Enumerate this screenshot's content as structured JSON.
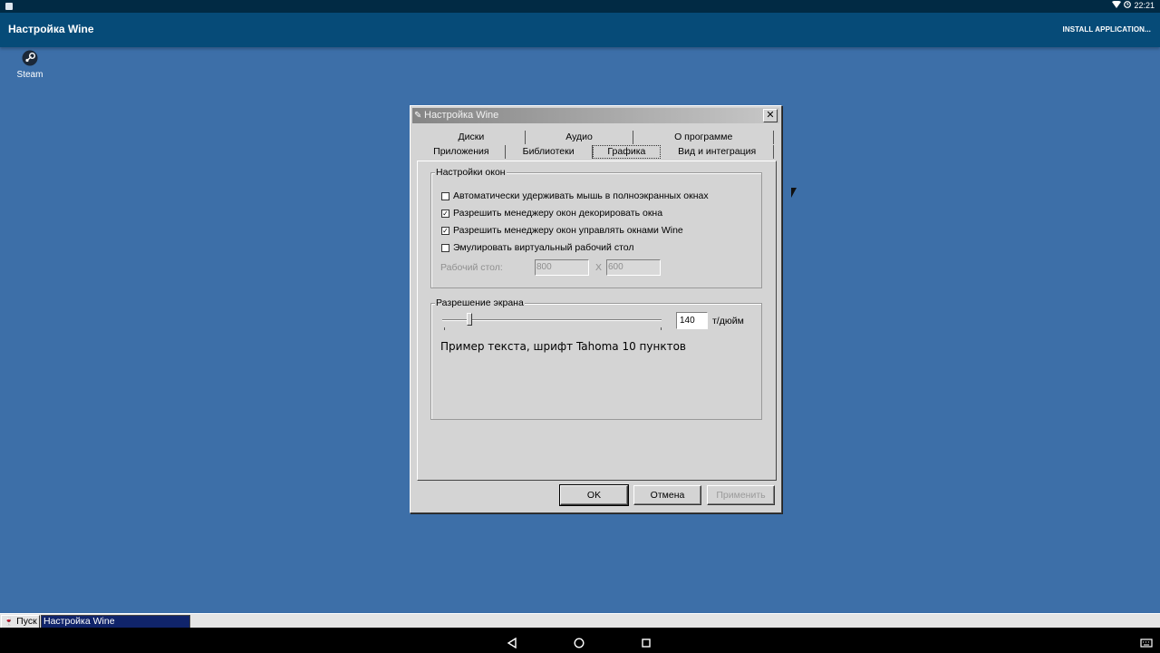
{
  "status_bar": {
    "time": "22:21",
    "wifi_icon": "wifi-icon",
    "alarm_icon": "alarm-icon"
  },
  "app_bar": {
    "title": "Настройка Wine",
    "action": "INSTALL APPLICATION..."
  },
  "desktop": {
    "icons": [
      {
        "label": "Steam",
        "icon": "steam-icon"
      }
    ]
  },
  "dialog": {
    "title": "Настройка Wine",
    "tabs_back": [
      "Диски",
      "Аудио",
      "О программе"
    ],
    "tabs_front": [
      "Приложения",
      "Библиотеки",
      "Графика",
      "Вид и интеграция"
    ],
    "active_tab": "Графика",
    "window_settings": {
      "legend": "Настройки окон",
      "options": [
        {
          "label": "Автоматически удерживать мышь в полноэкранных окнах",
          "checked": false
        },
        {
          "label": "Разрешить менеджеру окон декорировать окна",
          "checked": true
        },
        {
          "label": "Разрешить менеджеру окон управлять окнами Wine",
          "checked": true
        },
        {
          "label": "Эмулировать виртуальный рабочий стол",
          "checked": false
        }
      ],
      "desktop_label": "Рабочий стол:",
      "width_value": "800",
      "separator": "X",
      "height_value": "600"
    },
    "resolution": {
      "legend": "Разрешение экрана",
      "dpi_value": "140",
      "dpi_unit": "т/дюйм",
      "sample_text": "Пример текста, шрифт Tahoma 10 пунктов"
    },
    "buttons": {
      "ok": "OK",
      "cancel": "Отмена",
      "apply": "Применить"
    }
  },
  "taskbar": {
    "start_label": "Пуск",
    "items": [
      "Настройка Wine"
    ]
  },
  "colors": {
    "desktop": "#3d6fa8",
    "app_bar": "#064b78",
    "status_bar": "#012a44",
    "dialog_face": "#d4d4d4",
    "taskbar_active": "#10246a"
  }
}
